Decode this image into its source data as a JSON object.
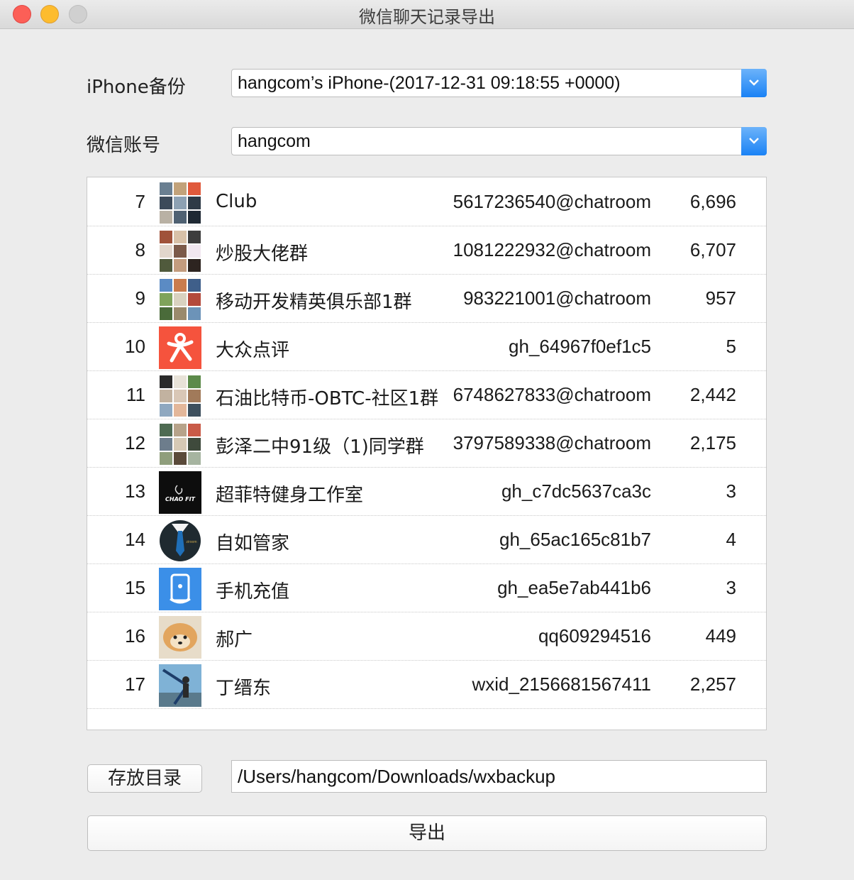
{
  "window": {
    "title": "微信聊天记录导出"
  },
  "form": {
    "backup_label": "iPhone备份",
    "backup_value": "hangcom’s iPhone-(2017-12-31 09:18:55 +0000)",
    "account_label": "微信账号",
    "account_value": "hangcom"
  },
  "chats": [
    {
      "index": "7",
      "name": "Club",
      "id": "5617236540@chatroom",
      "count": "6,696",
      "avatar": "group-avatar-icon"
    },
    {
      "index": "8",
      "name": "炒股大佬群",
      "id": "1081222932@chatroom",
      "count": "6,707",
      "avatar": "group-avatar-icon"
    },
    {
      "index": "9",
      "name": "移动开发精英俱乐部1群",
      "id": "983221001@chatroom",
      "count": "957",
      "avatar": "group-avatar-icon"
    },
    {
      "index": "10",
      "name": "大众点评",
      "id": "gh_64967f0ef1c5",
      "count": "5",
      "avatar": "dianping-logo-icon"
    },
    {
      "index": "11",
      "name": "石油比特币-OBTC-社区1群",
      "id": "6748627833@chatroom",
      "count": "2,442",
      "avatar": "group-avatar-icon"
    },
    {
      "index": "12",
      "name": "彭泽二中91级（1)同学群",
      "id": "3797589338@chatroom",
      "count": "2,175",
      "avatar": "group-avatar-icon"
    },
    {
      "index": "13",
      "name": "超菲特健身工作室",
      "id": "gh_c7dc5637ca3c",
      "count": "3",
      "avatar": "chao-fit-logo-icon"
    },
    {
      "index": "14",
      "name": "自如管家",
      "id": "gh_65ac165c81b7",
      "count": "4",
      "avatar": "suit-tie-avatar-icon"
    },
    {
      "index": "15",
      "name": "手机充值",
      "id": "gh_ea5e7ab441b6",
      "count": "3",
      "avatar": "phone-recharge-icon"
    },
    {
      "index": "16",
      "name": "郝广",
      "id": "qq609294516",
      "count": "449",
      "avatar": "dog-photo-avatar"
    },
    {
      "index": "17",
      "name": "丁缙东",
      "id": "wxid_2156681567411",
      "count": "2,257",
      "avatar": "photo-avatar"
    }
  ],
  "footer": {
    "dir_button": "存放目录",
    "path_value": "/Users/hangcom/Downloads/wxbackup",
    "export_button": "导出"
  },
  "colors": {
    "accent": "#1a82f5",
    "window_bg": "#ececec",
    "close": "#fc5f57",
    "minimize": "#fdbc2e",
    "dianping": "#f5533d",
    "recharge": "#3b8fe8"
  }
}
